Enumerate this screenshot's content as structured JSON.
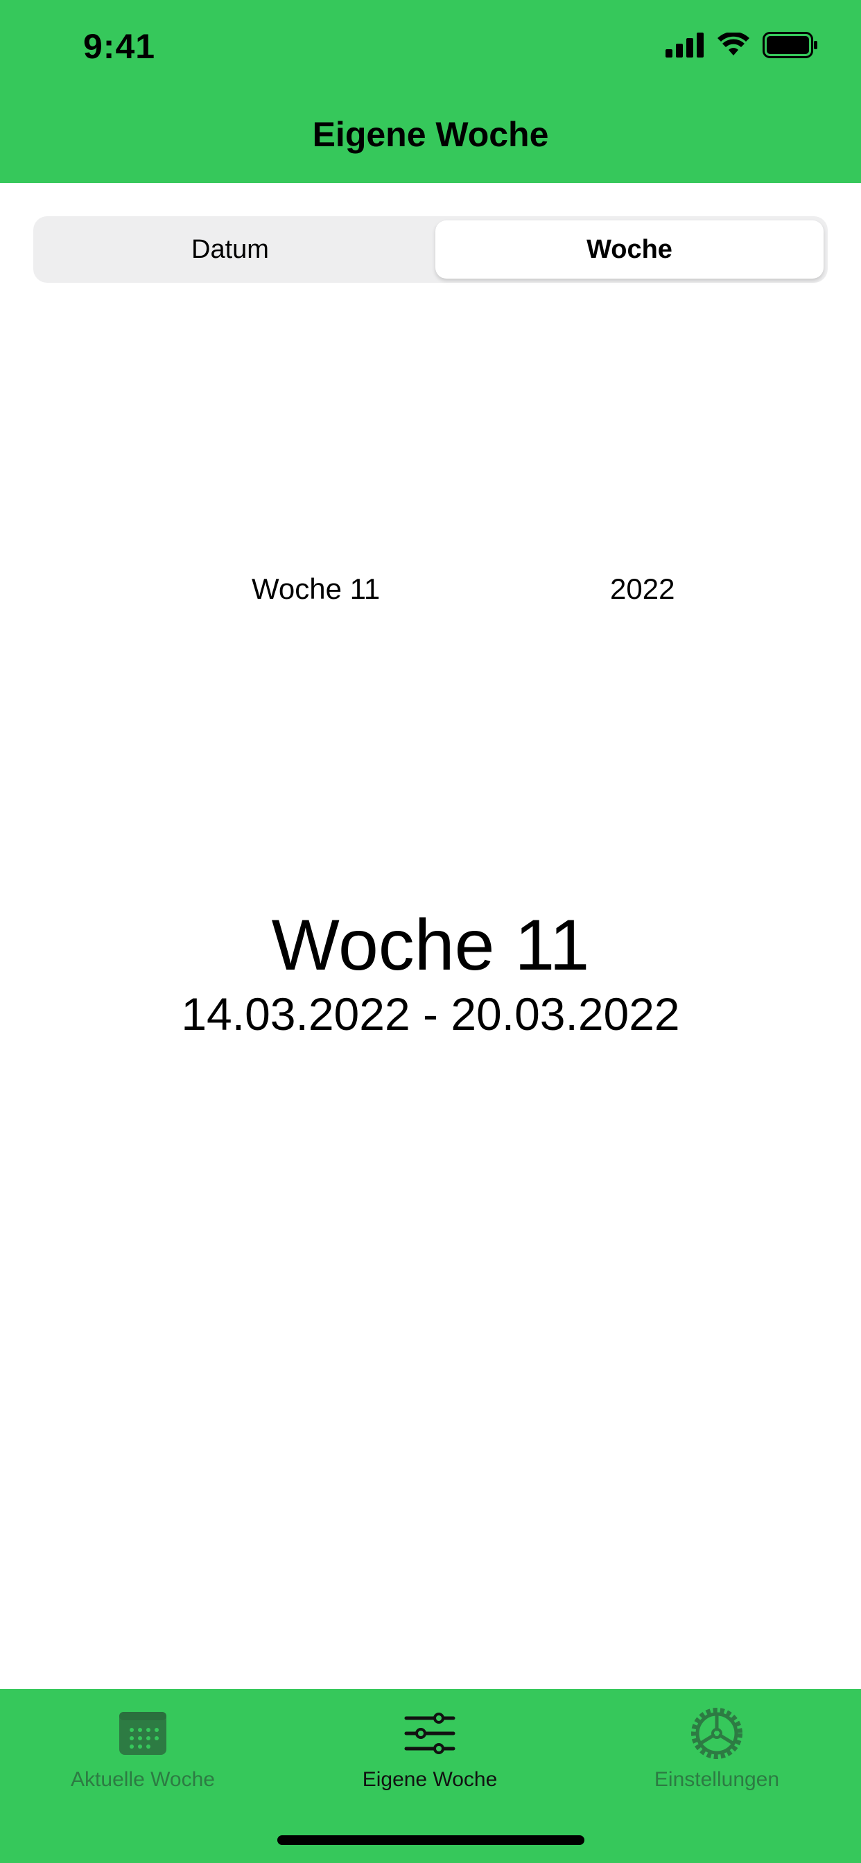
{
  "status_bar": {
    "time": "9:41"
  },
  "header": {
    "title": "Eigene Woche"
  },
  "segmented_control": {
    "options": [
      "Datum",
      "Woche"
    ],
    "selected": "Woche"
  },
  "picker": {
    "week_value": "Woche 11",
    "year_value": "2022"
  },
  "result": {
    "week_title": "Woche 11",
    "date_range": "14.03.2022 - 20.03.2022"
  },
  "tab_bar": {
    "items": [
      {
        "label": "Aktuelle Woche",
        "icon": "calendar-icon",
        "active": false
      },
      {
        "label": "Eigene Woche",
        "icon": "sliders-icon",
        "active": true
      },
      {
        "label": "Einstellungen",
        "icon": "settings-icon",
        "active": false
      }
    ]
  },
  "colors": {
    "brand_green": "#36c85b",
    "inactive_tab": "#2d7b43",
    "segment_background": "#eeeeef"
  }
}
